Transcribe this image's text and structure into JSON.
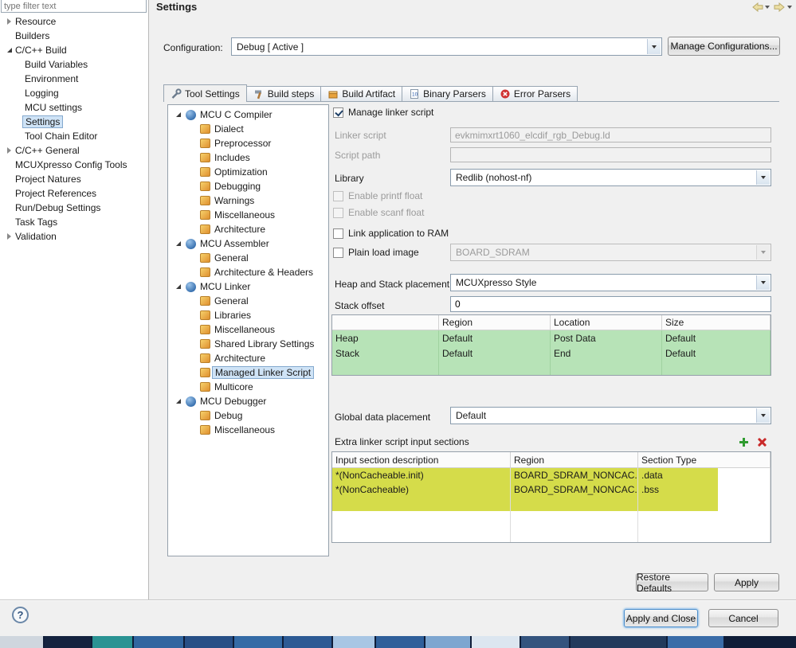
{
  "window": {
    "title": "Settings",
    "filter_placeholder": "type filter text",
    "help_glyph": "?"
  },
  "sidebar": {
    "items": [
      {
        "label": "Resource"
      },
      {
        "label": "Builders"
      },
      {
        "label": "C/C++ Build"
      },
      {
        "label": "Build Variables"
      },
      {
        "label": "Environment"
      },
      {
        "label": "Logging"
      },
      {
        "label": "MCU settings"
      },
      {
        "label": "Settings"
      },
      {
        "label": "Tool Chain Editor"
      },
      {
        "label": "C/C++ General"
      },
      {
        "label": "MCUXpresso Config Tools"
      },
      {
        "label": "Project Natures"
      },
      {
        "label": "Project References"
      },
      {
        "label": "Run/Debug Settings"
      },
      {
        "label": "Task Tags"
      },
      {
        "label": "Validation"
      }
    ]
  },
  "config": {
    "label": "Configuration:",
    "value": "Debug  [ Active ]",
    "manage": "Manage Configurations..."
  },
  "tabs": [
    {
      "label": "Tool Settings"
    },
    {
      "label": "Build steps"
    },
    {
      "label": "Build Artifact"
    },
    {
      "label": "Binary Parsers"
    },
    {
      "label": "Error Parsers"
    }
  ],
  "tool_tree": {
    "items": [
      {
        "label": "MCU C Compiler"
      },
      {
        "label": "Dialect"
      },
      {
        "label": "Preprocessor"
      },
      {
        "label": "Includes"
      },
      {
        "label": "Optimization"
      },
      {
        "label": "Debugging"
      },
      {
        "label": "Warnings"
      },
      {
        "label": "Miscellaneous"
      },
      {
        "label": "Architecture"
      },
      {
        "label": "MCU Assembler"
      },
      {
        "label": "General"
      },
      {
        "label": "Architecture & Headers"
      },
      {
        "label": "MCU Linker"
      },
      {
        "label": "General"
      },
      {
        "label": "Libraries"
      },
      {
        "label": "Miscellaneous"
      },
      {
        "label": "Shared Library Settings"
      },
      {
        "label": "Architecture"
      },
      {
        "label": "Managed Linker Script"
      },
      {
        "label": "Multicore"
      },
      {
        "label": "MCU Debugger"
      },
      {
        "label": "Debug"
      },
      {
        "label": "Miscellaneous"
      }
    ]
  },
  "form": {
    "manage_linker_script": "Manage linker script",
    "linker_script_label": "Linker script",
    "linker_script_value": "evkmimxrt1060_elcdif_rgb_Debug.ld",
    "script_path_label": "Script path",
    "script_path_value": "",
    "library_label": "Library",
    "library_value": "Redlib (nohost-nf)",
    "enable_printf": "Enable printf float",
    "enable_scanf": "Enable scanf float",
    "link_to_ram": "Link application to RAM",
    "plain_load_image": "Plain load image",
    "plain_load_value": "BOARD_SDRAM",
    "heap_stack_label": "Heap and Stack placement",
    "heap_stack_value": "MCUXpresso Style",
    "stack_offset_label": "Stack offset",
    "stack_offset_value": "0",
    "heap_table": {
      "columns": [
        "",
        "Region",
        "Location",
        "Size"
      ],
      "rows": [
        [
          "Heap",
          "Default",
          "Post Data",
          "Default"
        ],
        [
          "Stack",
          "Default",
          "End",
          "Default"
        ]
      ]
    },
    "global_label": "Global data placement",
    "global_value": "Default",
    "extra_label": "Extra linker script input sections",
    "extra_table": {
      "columns": [
        "Input section description",
        "Region",
        "Section Type"
      ],
      "rows": [
        [
          "*(NonCacheable.init)",
          "BOARD_SDRAM_NONCAC...",
          ".data"
        ],
        [
          "*(NonCacheable)",
          "BOARD_SDRAM_NONCAC...",
          ".bss"
        ]
      ]
    }
  },
  "buttons": {
    "restore": "Restore Defaults",
    "apply": "Apply",
    "apply_close": "Apply and Close",
    "cancel": "Cancel"
  }
}
